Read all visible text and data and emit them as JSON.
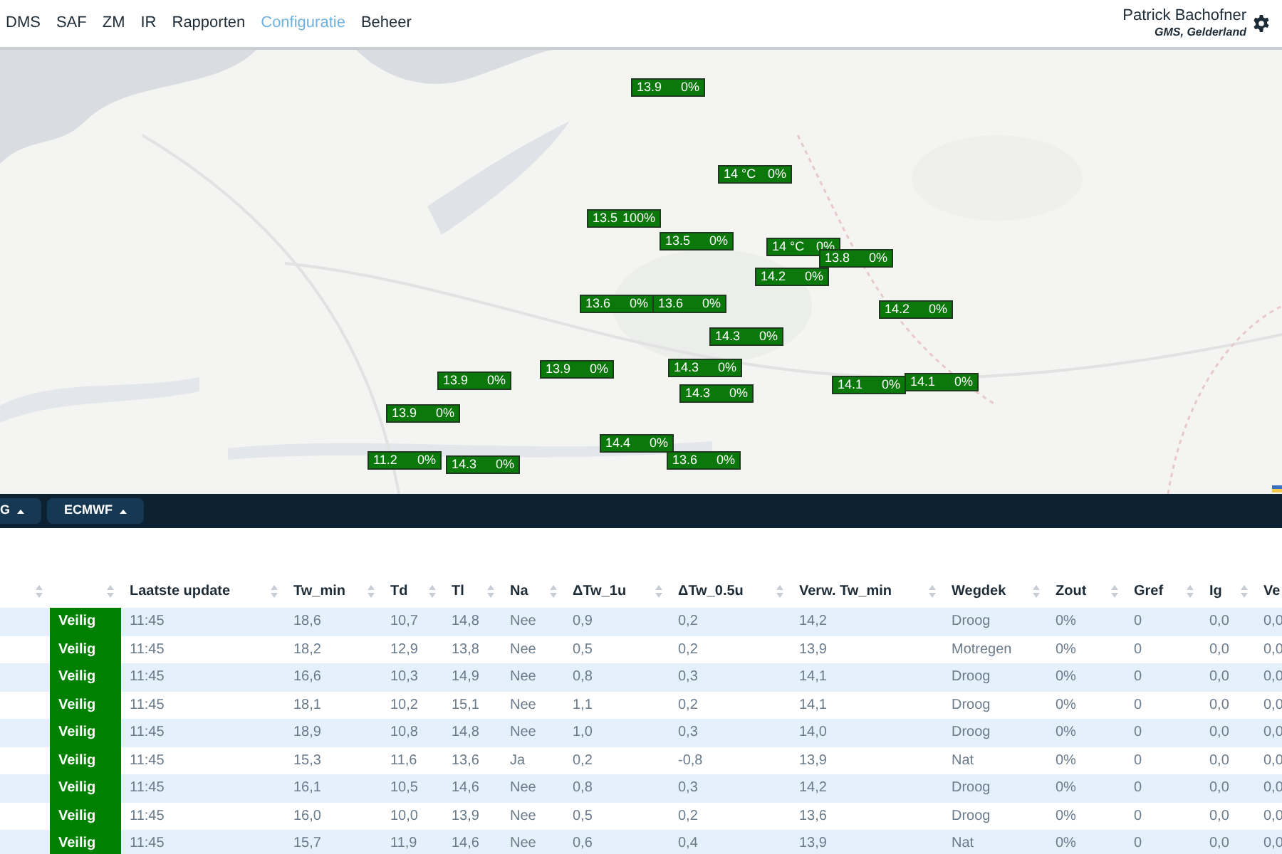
{
  "nav": {
    "items": [
      {
        "label": "DMS",
        "selected": false
      },
      {
        "label": "SAF",
        "selected": false
      },
      {
        "label": "ZM",
        "selected": false
      },
      {
        "label": "IR",
        "selected": false
      },
      {
        "label": "Rapporten",
        "selected": false
      },
      {
        "label": "Configuratie",
        "selected": true
      },
      {
        "label": "Beheer",
        "selected": false
      }
    ],
    "user": {
      "name": "Patrick Bachofner",
      "organisation": "GMS, Gelderland"
    }
  },
  "map": {
    "markers": [
      {
        "value": "13.9",
        "percent": "0%"
      },
      {
        "value": "14 °C",
        "percent": "0%"
      },
      {
        "value": "13.5",
        "percent": "100%"
      },
      {
        "value": "13.5",
        "percent": "0%"
      },
      {
        "value": "14 °C",
        "percent": "0%"
      },
      {
        "value": "13.8",
        "percent": "0%"
      },
      {
        "value": "14.2",
        "percent": "0%"
      },
      {
        "value": "13.6",
        "percent": "0%"
      },
      {
        "value": "13.6",
        "percent": "0%"
      },
      {
        "value": "14.2",
        "percent": "0%"
      },
      {
        "value": "14.3",
        "percent": "0%"
      },
      {
        "value": "13.9",
        "percent": "0%"
      },
      {
        "value": "14.3",
        "percent": "0%"
      },
      {
        "value": "13.9",
        "percent": "0%"
      },
      {
        "value": "14.1",
        "percent": "0%"
      },
      {
        "value": "14.1",
        "percent": "0%"
      },
      {
        "value": "14.3",
        "percent": "0%"
      },
      {
        "value": "13.9",
        "percent": "0%"
      },
      {
        "value": "14.4",
        "percent": "0%"
      },
      {
        "value": "11.2",
        "percent": "0%"
      },
      {
        "value": "14.3",
        "percent": "0%"
      },
      {
        "value": "13.6",
        "percent": "0%"
      }
    ]
  },
  "toolbar": {
    "buttons": [
      {
        "label": "G"
      },
      {
        "label": "ECMWF"
      }
    ]
  },
  "table": {
    "columns": [
      {},
      {},
      {
        "label": "Laatste update"
      },
      {
        "label": "Tw_min"
      },
      {
        "label": "Td"
      },
      {
        "label": "Tl"
      },
      {
        "label": "Na"
      },
      {
        "label": "ΔTw_1u"
      },
      {
        "label": "ΔTw_0.5u"
      },
      {
        "label": "Verw. Tw_min"
      },
      {
        "label": "Wegdek"
      },
      {
        "label": "Zout"
      },
      {
        "label": "Gref"
      },
      {
        "label": "Ig"
      },
      {
        "label": "Ve"
      }
    ],
    "rows": [
      {
        "color": "#008000",
        "cells": [
          "",
          "Veilig",
          "11:45",
          "18,6",
          "10,7",
          "14,8",
          "Nee",
          "0,9",
          "0,2",
          "14,2",
          "Droog",
          "0%",
          "0",
          "0,0",
          "0,0"
        ]
      },
      {
        "color": "#008000",
        "cells": [
          "",
          "Veilig",
          "11:45",
          "18,2",
          "12,9",
          "13,8",
          "Nee",
          "0,5",
          "0,2",
          "13,9",
          "Motregen",
          "0%",
          "0",
          "0,0",
          "0,0"
        ]
      },
      {
        "color": "#008000",
        "cells": [
          "",
          "Veilig",
          "11:45",
          "16,6",
          "10,3",
          "14,9",
          "Nee",
          "0,8",
          "0,3",
          "14,1",
          "Droog",
          "0%",
          "0",
          "0,0",
          "0,0"
        ]
      },
      {
        "color": "#008000",
        "cells": [
          "",
          "Veilig",
          "11:45",
          "18,1",
          "10,2",
          "15,1",
          "Nee",
          "1,1",
          "0,2",
          "14,1",
          "Droog",
          "0%",
          "0",
          "0,0",
          "0,0"
        ]
      },
      {
        "color": "#008000",
        "cells": [
          "",
          "Veilig",
          "11:45",
          "18,9",
          "10,8",
          "14,8",
          "Nee",
          "1,0",
          "0,3",
          "14,0",
          "Droog",
          "0%",
          "0",
          "0,0",
          "0,0"
        ]
      },
      {
        "color": "#008000",
        "cells": [
          "",
          "Veilig",
          "11:45",
          "15,3",
          "11,6",
          "13,6",
          "Ja",
          "0,2",
          "-0,8",
          "13,9",
          "Nat",
          "0%",
          "0",
          "0,0",
          "0,0"
        ]
      },
      {
        "color": "#008000",
        "cells": [
          "",
          "Veilig",
          "11:45",
          "16,1",
          "10,5",
          "14,6",
          "Nee",
          "0,8",
          "0,3",
          "14,2",
          "Droog",
          "0%",
          "0",
          "0,0",
          "0,0"
        ]
      },
      {
        "color": "#008000",
        "cells": [
          "",
          "Veilig",
          "11:45",
          "16,0",
          "10,0",
          "13,9",
          "Nee",
          "0,5",
          "0,2",
          "13,6",
          "Droog",
          "0%",
          "0",
          "0,0",
          "0,0"
        ]
      },
      {
        "color": "#008000",
        "cells": [
          "",
          "Veilig",
          "11:45",
          "15,7",
          "11,9",
          "14,6",
          "Nee",
          "0,6",
          "0,4",
          "13,9",
          "Nat",
          "0%",
          "0",
          "0,0",
          "0,0"
        ]
      }
    ]
  }
}
